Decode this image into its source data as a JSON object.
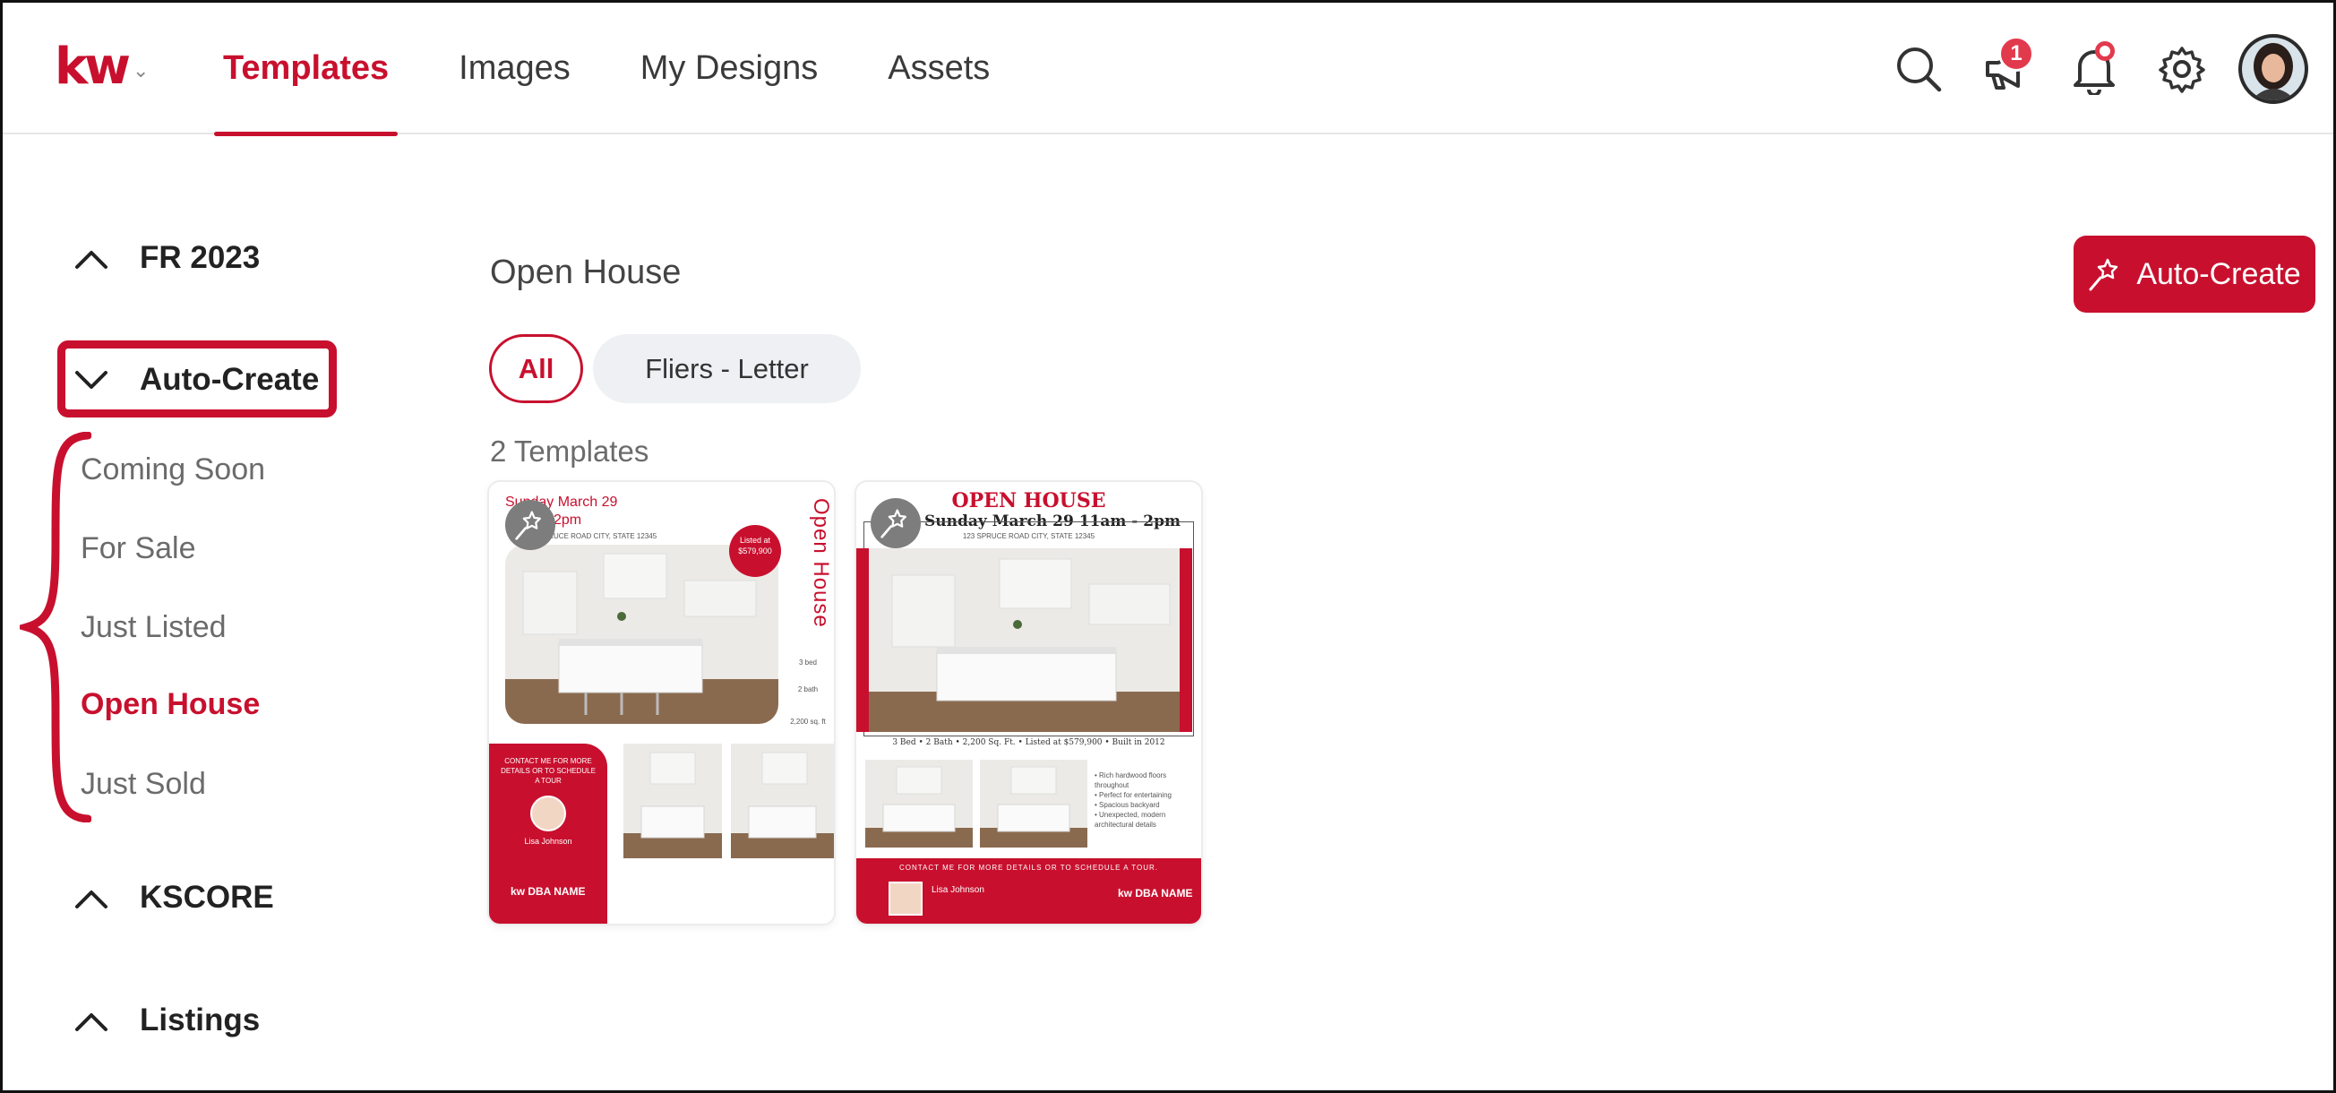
{
  "header": {
    "logo": "kw",
    "nav": [
      {
        "label": "Templates",
        "active": true
      },
      {
        "label": "Images",
        "active": false
      },
      {
        "label": "My Designs",
        "active": false
      },
      {
        "label": "Assets",
        "active": false
      }
    ],
    "icons": [
      "search-icon",
      "megaphone-icon",
      "bell-icon",
      "gear-icon",
      "avatar"
    ],
    "announcement_badge": "1"
  },
  "sidebar": {
    "group_fr2023": "FR 2023",
    "group_autocreate": "Auto-Create",
    "items": [
      "Coming Soon",
      "For Sale",
      "Just Listed",
      "Open House",
      "Just Sold"
    ],
    "active_item": "Open House",
    "group_kscore": "KSCORE",
    "group_listings": "Listings"
  },
  "main": {
    "title": "Open House",
    "auto_create_label": "Auto-Create",
    "chips": [
      "All",
      "Fliers - Letter"
    ],
    "count_label": "2 Templates"
  },
  "cards": {
    "card1": {
      "date": "Sunday March 29",
      "time": "2pm",
      "address": "123 SPRUCE ROAD CITY, STATE 12345",
      "vertical_title": "Open House",
      "listed_at": "Listed at",
      "price": "$579,900",
      "beds": "3 bed",
      "baths": "2 bath",
      "sqft": "2,200 sq. ft",
      "contact": "CONTACT ME FOR MORE DETAILS OR TO SCHEDULE A TOUR",
      "agent": "Lisa Johnson",
      "brand": "kw DBA NAME"
    },
    "card2": {
      "heading": "OPEN HOUSE",
      "date": "Sunday March 29 11am - 2pm",
      "address": "123 SPRUCE ROAD CITY, STATE 12345",
      "features": "3 Bed  •  2 Bath  •  2,200 Sq. Ft.  •  Listed at $579,900  •  Built in 2012",
      "bullets": [
        "Rich hardwood floors throughout",
        "Perfect for entertaining",
        "Spacious backyard",
        "Unexpected, modern architectural details"
      ],
      "contact": "CONTACT ME FOR MORE DETAILS OR TO SCHEDULE A TOUR.",
      "agent": "Lisa Johnson",
      "brand": "kw DBA NAME"
    }
  },
  "colors": {
    "brand": "#c8102e",
    "badge": "#e23a4d",
    "chip_bg": "#eef0f3"
  }
}
